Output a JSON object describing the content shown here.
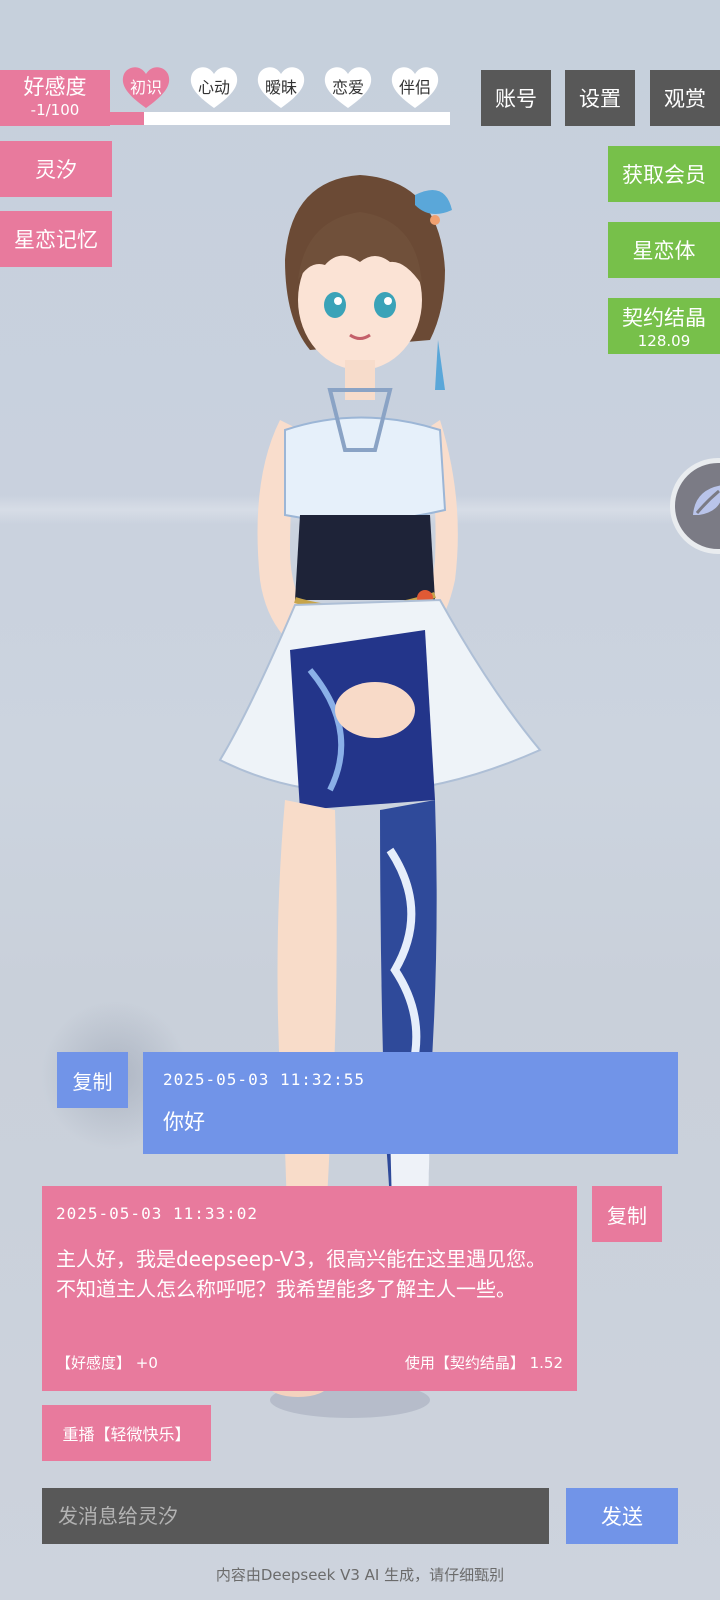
{
  "favor": {
    "title": "好感度",
    "value": "-1/100",
    "progress": 0.1
  },
  "relationship_stages": [
    {
      "label": "初识",
      "active": true
    },
    {
      "label": "心动",
      "active": false
    },
    {
      "label": "暧昧",
      "active": false
    },
    {
      "label": "恋爱",
      "active": false
    },
    {
      "label": "伴侣",
      "active": false
    }
  ],
  "top_menu": {
    "account": "账号",
    "settings": "设置",
    "view": "观赏"
  },
  "left_menu": {
    "character_name": "灵汐",
    "memory": "星恋记忆"
  },
  "right_menu": {
    "membership": "获取会员",
    "body": "星恋体",
    "crystal_label": "契约结晶",
    "crystal_value": "128.09"
  },
  "chat": {
    "copy_label": "复制",
    "user_message": {
      "time": "2025-05-03 11:32:55",
      "text": "你好"
    },
    "ai_message": {
      "time": "2025-05-03 11:33:02",
      "text": "主人好，我是deepseep-V3，很高兴能在这里遇见您。不知道主人怎么称呼呢？我希望能多了解主人一些。",
      "favor_change": "【好感度】 +0",
      "cost": "使用【契约结晶】 1.52"
    },
    "replay": "重播【轻微快乐】"
  },
  "input": {
    "placeholder": "发消息给灵汐",
    "send": "发送"
  },
  "disclaimer": "内容由Deepseek V3 AI 生成，请仔细甄别",
  "colors": {
    "pink": "#e87a9d",
    "green": "#77c04a",
    "gray": "#585858",
    "blue": "#7194e8"
  }
}
